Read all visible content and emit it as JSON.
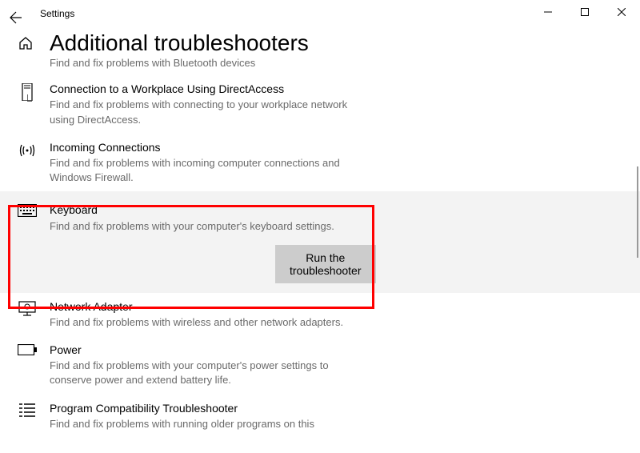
{
  "window": {
    "title": "Settings"
  },
  "page": {
    "title": "Additional troubleshooters"
  },
  "partial_top": {
    "desc": "Find and fix problems with Bluetooth devices"
  },
  "items": [
    {
      "title": "Connection to a Workplace Using DirectAccess",
      "desc": "Find and fix problems with connecting to your workplace network using DirectAccess."
    },
    {
      "title": "Incoming Connections",
      "desc": "Find and fix problems with incoming computer connections and Windows Firewall."
    },
    {
      "title": "Keyboard",
      "desc": "Find and fix problems with your computer's keyboard settings."
    },
    {
      "title": "Network Adapter",
      "desc": "Find and fix problems with wireless and other network adapters."
    },
    {
      "title": "Power",
      "desc": "Find and fix problems with your computer's power settings to conserve power and extend battery life."
    },
    {
      "title": "Program Compatibility Troubleshooter",
      "desc": "Find and fix problems with running older programs on this"
    }
  ],
  "actions": {
    "run": "Run the troubleshooter"
  }
}
